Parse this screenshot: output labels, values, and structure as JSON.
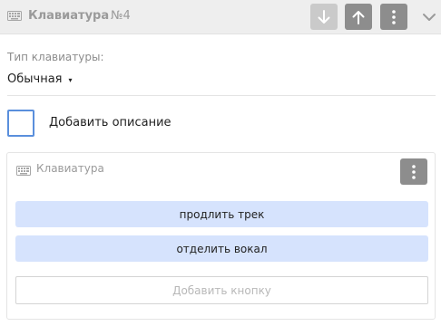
{
  "header": {
    "title": "Клавиатура",
    "number": "№4",
    "icon": "keyboard-icon",
    "move_down_icon": "arrow-down-icon",
    "move_up_icon": "arrow-up-icon",
    "menu_icon": "vertical-dots-icon",
    "collapse_icon": "chevron-down-icon"
  },
  "keyboard_type": {
    "label": "Тип клавиатуры:",
    "value": "Обычная",
    "caret": "▾"
  },
  "description_toggle": {
    "label": "Добавить описание",
    "checked": false
  },
  "keyboard_card": {
    "title": "Клавиатура",
    "icon": "keyboard-icon",
    "menu_icon": "vertical-dots-icon",
    "buttons": [
      {
        "label": "продлить трек"
      },
      {
        "label": "отделить вокал"
      }
    ],
    "add_button_label": "Добавить кнопку"
  },
  "colors": {
    "accent": "#5a8fdc",
    "button_bg": "#d6e3fd",
    "header_bg": "#eeeeee",
    "control_dark": "#8d8d8d",
    "control_light": "#cacaca"
  }
}
